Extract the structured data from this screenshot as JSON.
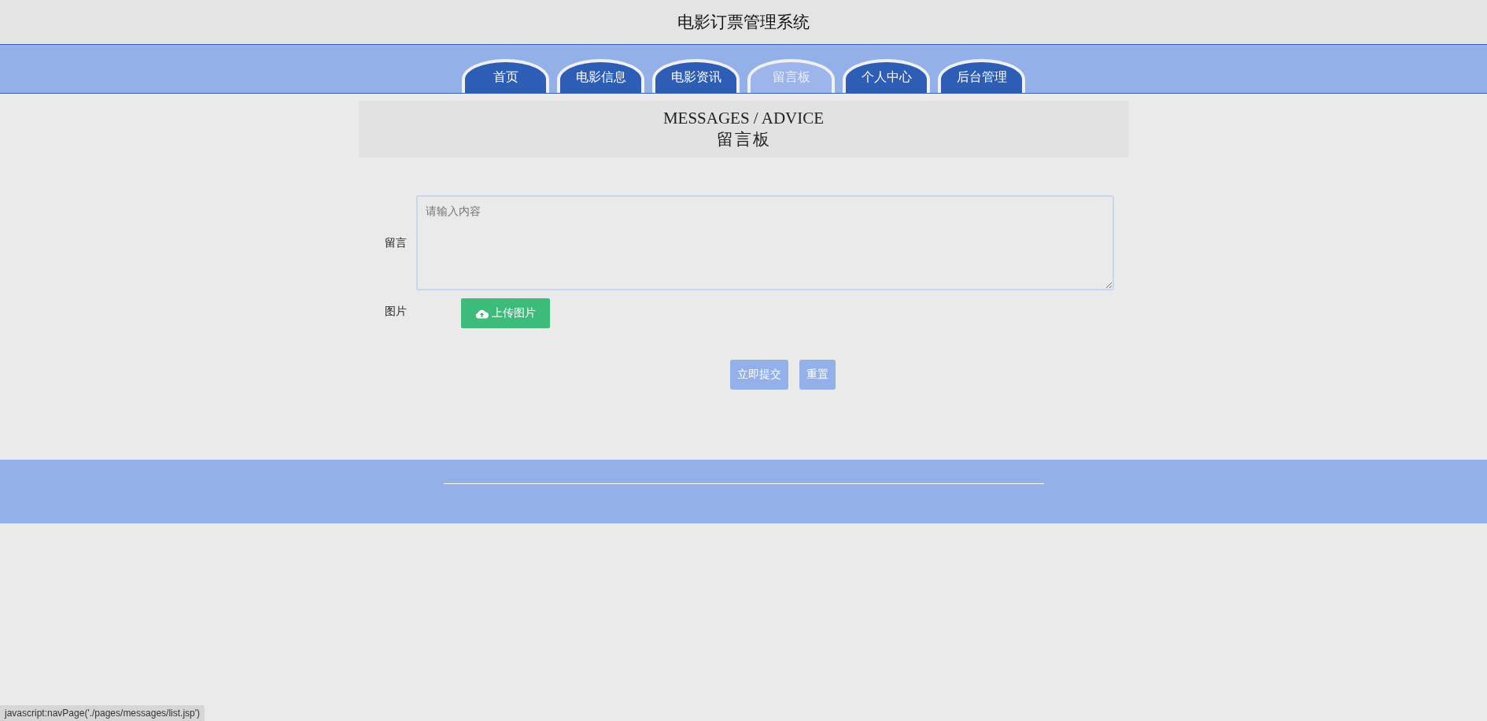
{
  "header": {
    "title": "电影订票管理系统"
  },
  "tabs": [
    {
      "label": "首页",
      "selected": false
    },
    {
      "label": "电影信息",
      "selected": false
    },
    {
      "label": "电影资讯",
      "selected": false
    },
    {
      "label": "留言板",
      "selected": true
    },
    {
      "label": "个人中心",
      "selected": false
    },
    {
      "label": "后台管理",
      "selected": false
    }
  ],
  "page_heading": {
    "title": "MESSAGES / ADVICE",
    "subtitle": "留言板"
  },
  "form": {
    "message_label": "留言",
    "message_placeholder": "请输入内容",
    "image_label": "图片",
    "upload_button": "上传图片",
    "submit_button": "立即提交",
    "reset_button": "重置"
  },
  "status_bar": {
    "text": "javascript:navPage('./pages/messages/list.jsp')"
  }
}
